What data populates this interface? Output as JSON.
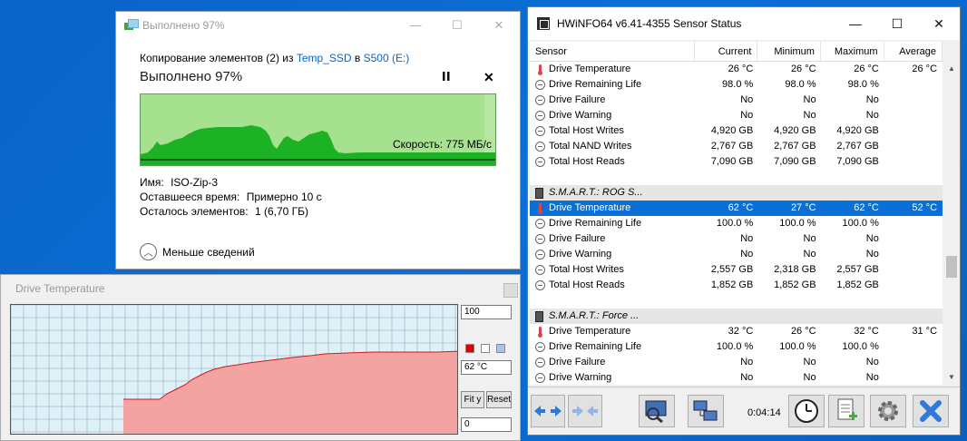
{
  "copy_dialog": {
    "title": "Выполнено 97%",
    "header_prefix": "Копирование элементов (2) из ",
    "source": "Temp_SSD",
    "header_mid": " в ",
    "dest": "S500 (E:)",
    "percent_text": "Выполнено 97%",
    "progress": 0.97,
    "speed_label": "Скорость: 775 МБ/с",
    "name_label": "Имя:",
    "name_value": "ISO-Zip-3",
    "time_label": "Оставшееся время:",
    "time_value": "Примерно 10 с",
    "items_label": "Осталось элементов:",
    "items_value": "1 (6,70 ГБ)",
    "less_details": "Меньше сведений",
    "minimize": "—",
    "maximize": "☐",
    "close": "✕",
    "pause_icon": "pause-icon",
    "colors": {
      "progress": "#a6e18f",
      "area": "#1db226",
      "link": "#0b63c4"
    }
  },
  "temp_window": {
    "title": "Drive Temperature",
    "max_value": "100",
    "current_value": "62 °C",
    "min_value": "0",
    "fit_y": "Fit y",
    "reset": "Reset",
    "swatch_colors": [
      "#e00000",
      "#ffffff",
      "#a8c4ec"
    ],
    "colors": {
      "fill": "#f4a3a3",
      "line": "#c81d1d",
      "grid": "#9cbfcf",
      "bg": "#dff1f7"
    }
  },
  "hwinfo": {
    "title": "HWiNFO64 v6.41-4355 Sensor Status",
    "minimize": "—",
    "maximize": "☐",
    "close": "✕",
    "columns": [
      "Sensor",
      "Current",
      "Minimum",
      "Maximum",
      "Average"
    ],
    "rows": [
      {
        "kind": "therm",
        "name": "Drive Temperature",
        "cur": "26 °C",
        "min": "26 °C",
        "max": "26 °C",
        "avg": "26 °C"
      },
      {
        "kind": "circ",
        "name": "Drive Remaining Life",
        "cur": "98.0 %",
        "min": "98.0 %",
        "max": "98.0 %",
        "avg": ""
      },
      {
        "kind": "circ",
        "name": "Drive Failure",
        "cur": "No",
        "min": "No",
        "max": "No",
        "avg": ""
      },
      {
        "kind": "circ",
        "name": "Drive Warning",
        "cur": "No",
        "min": "No",
        "max": "No",
        "avg": ""
      },
      {
        "kind": "circ",
        "name": "Total Host Writes",
        "cur": "4,920 GB",
        "min": "4,920 GB",
        "max": "4,920 GB",
        "avg": ""
      },
      {
        "kind": "circ",
        "name": "Total NAND Writes",
        "cur": "2,767 GB",
        "min": "2,767 GB",
        "max": "2,767 GB",
        "avg": ""
      },
      {
        "kind": "circ",
        "name": "Total Host Reads",
        "cur": "7,090 GB",
        "min": "7,090 GB",
        "max": "7,090 GB",
        "avg": ""
      },
      {
        "kind": "blank",
        "name": "",
        "cur": "",
        "min": "",
        "max": "",
        "avg": ""
      },
      {
        "kind": "group",
        "name": "S.M.A.R.T.: ROG S...",
        "cur": "",
        "min": "",
        "max": "",
        "avg": ""
      },
      {
        "kind": "therm",
        "name": "Drive Temperature",
        "cur": "62 °C",
        "min": "27 °C",
        "max": "62 °C",
        "avg": "52 °C",
        "selected": true
      },
      {
        "kind": "circ",
        "name": "Drive Remaining Life",
        "cur": "100.0 %",
        "min": "100.0 %",
        "max": "100.0 %",
        "avg": ""
      },
      {
        "kind": "circ",
        "name": "Drive Failure",
        "cur": "No",
        "min": "No",
        "max": "No",
        "avg": ""
      },
      {
        "kind": "circ",
        "name": "Drive Warning",
        "cur": "No",
        "min": "No",
        "max": "No",
        "avg": ""
      },
      {
        "kind": "circ",
        "name": "Total Host Writes",
        "cur": "2,557 GB",
        "min": "2,318 GB",
        "max": "2,557 GB",
        "avg": ""
      },
      {
        "kind": "circ",
        "name": "Total Host Reads",
        "cur": "1,852 GB",
        "min": "1,852 GB",
        "max": "1,852 GB",
        "avg": ""
      },
      {
        "kind": "blank",
        "name": "",
        "cur": "",
        "min": "",
        "max": "",
        "avg": ""
      },
      {
        "kind": "group",
        "name": "S.M.A.R.T.: Force ...",
        "cur": "",
        "min": "",
        "max": "",
        "avg": ""
      },
      {
        "kind": "therm",
        "name": "Drive Temperature",
        "cur": "32 °C",
        "min": "26 °C",
        "max": "32 °C",
        "avg": "31 °C"
      },
      {
        "kind": "circ",
        "name": "Drive Remaining Life",
        "cur": "100.0 %",
        "min": "100.0 %",
        "max": "100.0 %",
        "avg": ""
      },
      {
        "kind": "circ",
        "name": "Drive Failure",
        "cur": "No",
        "min": "No",
        "max": "No",
        "avg": ""
      },
      {
        "kind": "circ",
        "name": "Drive Warning",
        "cur": "No",
        "min": "No",
        "max": "No",
        "avg": ""
      }
    ],
    "timer": "0:04:14",
    "toolbar_icons": [
      "expand-arrows-icon",
      "collapse-arrows-icon",
      "sensor-view-icon",
      "network-icon",
      "clock-icon",
      "report-add-icon",
      "settings-gear-icon",
      "close-x-icon"
    ],
    "colors": {
      "selected": "#0a6fd6",
      "group_bg": "#e6e6e6"
    }
  }
}
